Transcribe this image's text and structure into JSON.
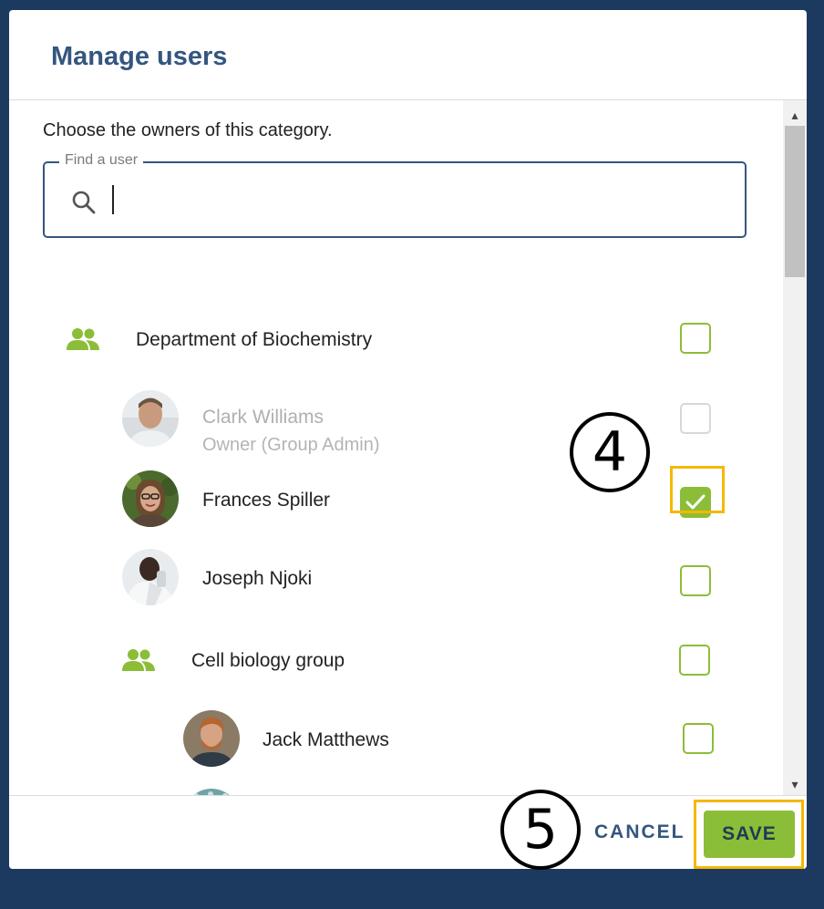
{
  "dialog": {
    "title": "Manage users",
    "instructions": "Choose the owners of this category.",
    "search": {
      "label": "Find a user",
      "value": ""
    }
  },
  "rows": [
    {
      "type": "group",
      "label": "Department of Biochemistry",
      "checked": false,
      "disabled": false
    },
    {
      "type": "user",
      "label": "Clark Williams",
      "subtitle": "Owner (Group Admin)",
      "checked": false,
      "disabled": true
    },
    {
      "type": "user",
      "label": "Frances Spiller",
      "checked": true,
      "disabled": false
    },
    {
      "type": "user",
      "label": "Joseph Njoki",
      "checked": false,
      "disabled": false
    },
    {
      "type": "group",
      "label": "Cell biology group",
      "checked": false,
      "disabled": false
    },
    {
      "type": "user",
      "label": "Jack Matthews",
      "checked": false,
      "disabled": false
    }
  ],
  "footer": {
    "cancel_label": "CANCEL",
    "save_label": "SAVE"
  },
  "annotations": {
    "step_4": "4",
    "step_5": "5"
  },
  "colors": {
    "accent_green": "#8cbd38",
    "title_blue": "#34567f",
    "highlight": "#f5b800",
    "backdrop": "#1b3559"
  }
}
